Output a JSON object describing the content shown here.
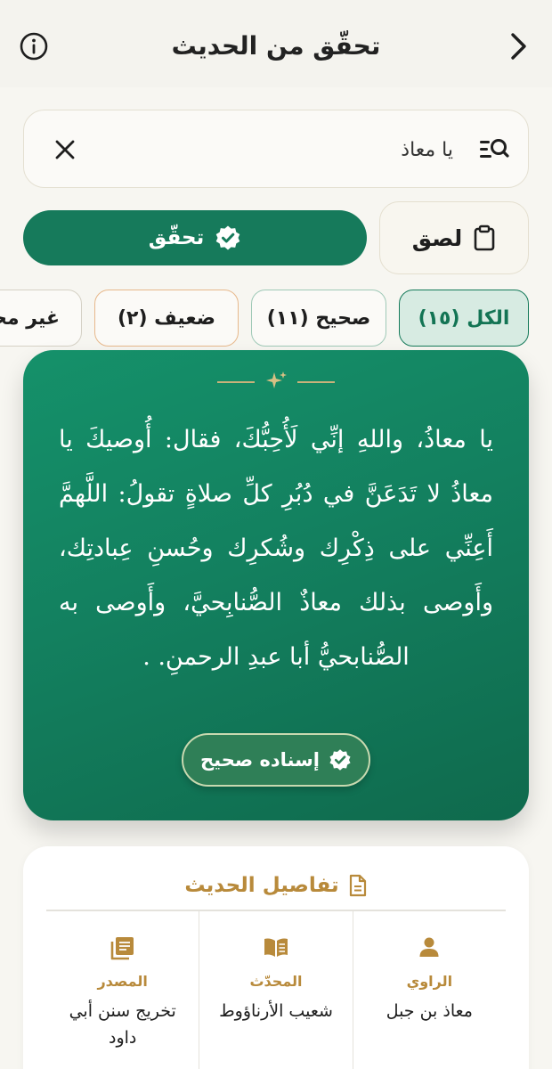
{
  "header": {
    "title": "تحقّق من الحديث",
    "info_icon": "info-circle-icon",
    "back_icon": "chevron-right-icon"
  },
  "search": {
    "value": "يا معاذ",
    "placeholder": "",
    "search_icon": "list-search-icon",
    "clear_icon": "close-icon"
  },
  "actions": {
    "paste_label": "لصق",
    "paste_icon": "clipboard-icon",
    "verify_label": "تحقّق",
    "verify_icon": "verified-badge-icon"
  },
  "filters": [
    {
      "label": "الكل (١٥)",
      "selected": true
    },
    {
      "label": "صحيح (١١)",
      "selected": false
    },
    {
      "label": "ضعيف (٢)",
      "selected": false
    },
    {
      "label": "غير محدد",
      "selected": false
    }
  ],
  "hadith_card": {
    "text": "يا معاذُ، واللهِ إنِّي لَأُحِبُّكَ، فقال: أُوصيكَ يا معاذُ لا تَدَعَنَّ في دُبُرِ كلِّ صلاةٍ تقولُ: اللَّهمَّ أَعِنِّي على ذِكْرِك وشُكرِك وحُسنِ عِبادتِك، وأَوصى بذلك معاذٌ الصُّنابِحيَّ، وأَوصى به الصُّنابحيُّ أبا عبدِ الرحمنِ. .",
    "grade_label": "إسناده صحيح",
    "grade_icon": "verified-badge-icon",
    "ornament_icon": "sparkle-icon"
  },
  "details": {
    "title": "تفاصيل الحديث",
    "title_icon": "document-icon",
    "columns": [
      {
        "label": "الراوي",
        "value": "معاذ بن جبل",
        "icon": "person-icon"
      },
      {
        "label": "المحدّث",
        "value": "شعيب الأرناؤوط",
        "icon": "open-book-icon"
      },
      {
        "label": "المصدر",
        "value": "تخريج سنن أبي داود",
        "icon": "book-list-icon"
      }
    ]
  },
  "colors": {
    "primary": "#167a5b",
    "accent_gold": "#b88a3b",
    "background": "#f7f6f1",
    "chip_selected_bg": "#d7ebe2",
    "daif_border": "#e7b88b"
  }
}
